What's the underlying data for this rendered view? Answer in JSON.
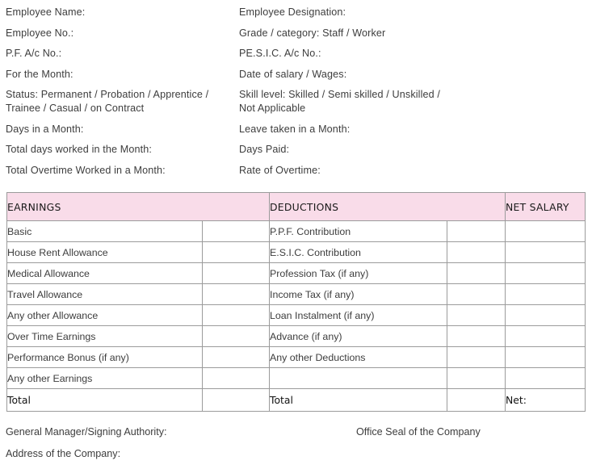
{
  "document": {
    "type": "salary-slip-form",
    "accent_color": "#f9dce9",
    "border_color": "#9b9b9b",
    "text_color": "#3d3d3d"
  },
  "header_fields": [
    {
      "left": "Employee Name:",
      "right": "Employee Designation:"
    },
    {
      "left": "Employee No.:",
      "right": "Grade / category: Staff / Worker"
    },
    {
      "left": "P.F. A/c No.:",
      "right": "PE.S.I.C. A/c No.:"
    },
    {
      "left": "For the Month:",
      "right": "Date of salary / Wages:"
    },
    {
      "left": "Status: Permanent / Probation / Apprentice /\nTrainee / Casual / on Contract",
      "right": "Skill level: Skilled / Semi skilled / Unskilled /\nNot Applicable"
    },
    {
      "left": "Days in a Month:",
      "right": "Leave taken in a Month:"
    },
    {
      "left": "Total days worked in the Month:",
      "right": "Days Paid:"
    },
    {
      "left": "Total Overtime Worked in a Month:",
      "right": "Rate of Overtime:"
    }
  ],
  "table": {
    "headers": {
      "earnings": "EARNINGS",
      "deductions": "DEDUCTIONS",
      "net_salary": "NET SALARY"
    },
    "earnings_items": [
      "Basic",
      "House Rent Allowance",
      "Medical Allowance",
      "Travel Allowance",
      "Any other Allowance",
      "Over Time Earnings",
      "Performance Bonus (if any)",
      "Any other Earnings"
    ],
    "deductions_items": [
      "P.P.F. Contribution",
      "E.S.I.C. Contribution",
      "Profession Tax (if any)",
      "Income Tax (if any)",
      "Loan Instalment (if any)",
      "Advance (if any)",
      "Any other Deductions",
      ""
    ],
    "earnings_values": [
      "",
      "",
      "",
      "",
      "",
      "",
      "",
      ""
    ],
    "deductions_values": [
      "",
      "",
      "",
      "",
      "",
      "",
      "",
      ""
    ],
    "net_values": [
      "",
      "",
      "",
      "",
      "",
      "",
      "",
      ""
    ],
    "total_earnings_label": "Total",
    "total_earnings_value": "",
    "total_deductions_label": "Total",
    "total_deductions_value": "",
    "net_label": "Net:",
    "net_value": ""
  },
  "footer": {
    "signing_authority": "General Manager/Signing Authority:",
    "office_seal": "Office Seal of the Company",
    "address": "Address of the Company:"
  }
}
